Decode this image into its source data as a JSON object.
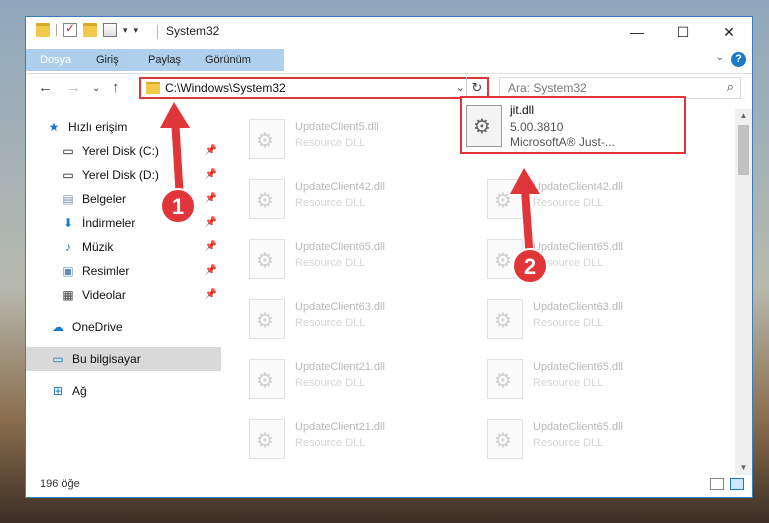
{
  "window": {
    "title": "System32",
    "controls": {
      "minimize": "—",
      "maximize": "☐",
      "close": "✕"
    }
  },
  "ribbon": {
    "tabs": [
      {
        "label": "Dosya"
      },
      {
        "label": "Giriş"
      },
      {
        "label": "Paylaş"
      },
      {
        "label": "Görünüm"
      }
    ],
    "help": "?"
  },
  "nav": {
    "address": "C:\\Windows\\System32",
    "search_placeholder": "Ara: System32"
  },
  "sidebar": {
    "items": [
      {
        "label": "Hızlı erişim",
        "icon": "star-icon"
      },
      {
        "label": "Yerel Disk (C:)",
        "icon": "drive-icon"
      },
      {
        "label": "Yerel Disk (D:)",
        "icon": "drive-icon"
      },
      {
        "label": "Belgeler",
        "icon": "documents-icon"
      },
      {
        "label": "İndirmeler",
        "icon": "download-icon"
      },
      {
        "label": "Müzik",
        "icon": "music-icon"
      },
      {
        "label": "Resimler",
        "icon": "pictures-icon"
      },
      {
        "label": "Videolar",
        "icon": "videos-icon"
      },
      {
        "label": "OneDrive",
        "icon": "cloud-icon"
      },
      {
        "label": "Bu bilgisayar",
        "icon": "computer-icon"
      },
      {
        "label": "Ağ",
        "icon": "network-icon"
      }
    ]
  },
  "files": {
    "left": [
      {
        "name": "UpdateClient5.dll",
        "desc": "Resource DLL"
      },
      {
        "name": "UpdateClient42.dll",
        "desc": "Resource DLL"
      },
      {
        "name": "UpdateClient65.dll",
        "desc": "Resource DLL"
      },
      {
        "name": "UpdateClient63.dll",
        "desc": "Resource DLL"
      },
      {
        "name": "UpdateClient21.dll",
        "desc": "Resource DLL"
      },
      {
        "name": "UpdateClient21.dll",
        "desc": "Resource DLL"
      }
    ],
    "right": [
      {
        "name": "UpdateClient42.dll",
        "desc": "Resource DLL"
      },
      {
        "name": "UpdateClient65.dll",
        "desc": "Resource DLL"
      },
      {
        "name": "UpdateClient63.dll",
        "desc": "Resource DLL"
      },
      {
        "name": "UpdateClient65.dll",
        "desc": "Resource DLL"
      },
      {
        "name": "UpdateClient65.dll",
        "desc": "Resource DLL"
      }
    ],
    "highlighted": {
      "name": "jit.dll",
      "version": "5.00.3810",
      "desc": "MicrosoftA® Just-..."
    }
  },
  "status": {
    "count": "196 öğe"
  },
  "annotations": {
    "step1": "1",
    "step2": "2",
    "color": "#e0363a"
  }
}
